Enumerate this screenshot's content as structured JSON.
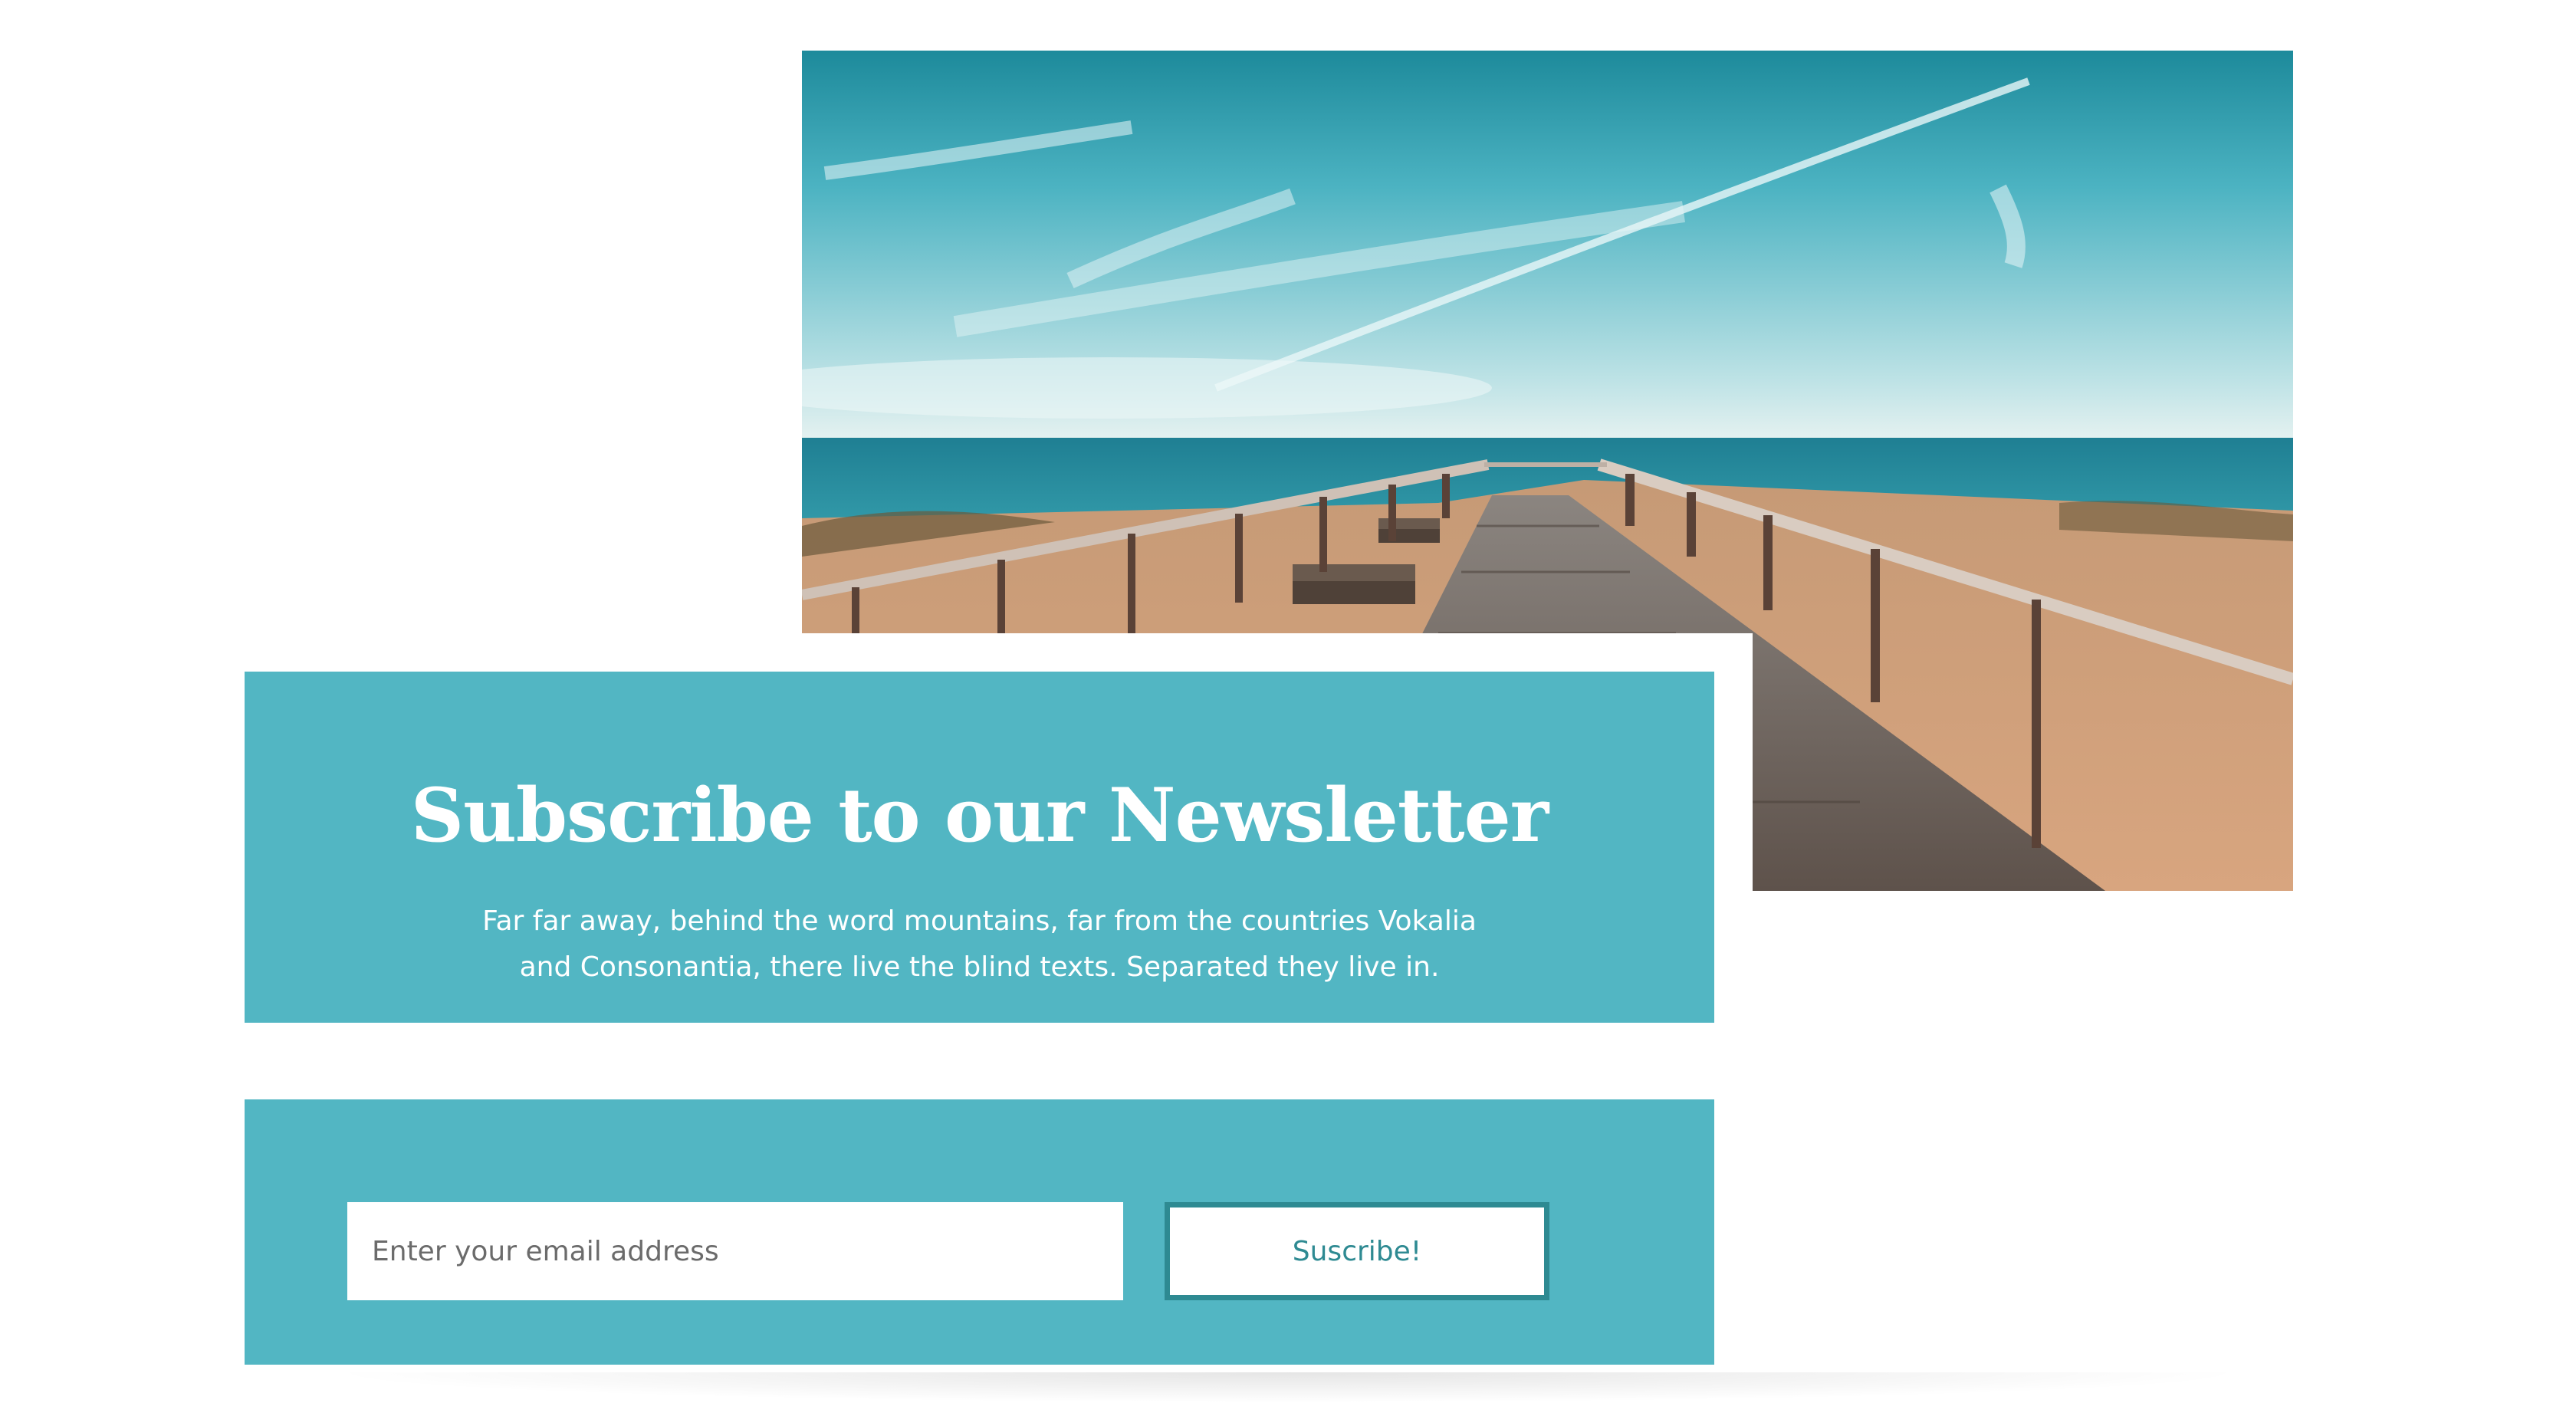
{
  "hero": {
    "image_description_icon": "boardwalk-beach-photo"
  },
  "newsletter": {
    "title": "Subscribe to our Newsletter",
    "description_line1": "Far far away, behind the word mountains, far from the countries Vokalia",
    "description_line2": "and Consonantia, there live the blind texts. Separated they live in."
  },
  "form": {
    "email_placeholder": "Enter your email address",
    "email_value": "",
    "submit_label": "Suscribe!"
  },
  "colors": {
    "panel_teal": "#52b6c3",
    "button_border": "#2e8a92",
    "button_text": "#2e8a92",
    "text_on_teal": "#ffffff"
  }
}
